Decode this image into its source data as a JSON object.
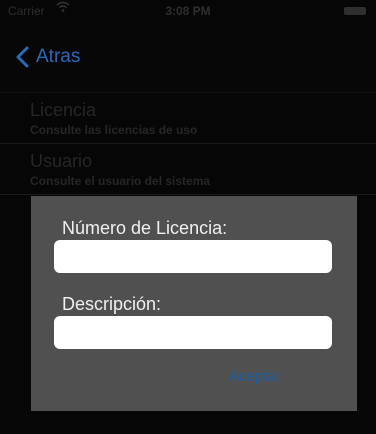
{
  "status_bar": {
    "carrier": "Carrier",
    "time": "3:08 PM",
    "wifi_icon": "wifi-icon",
    "battery_icon": "battery-icon"
  },
  "nav": {
    "back_label": "Atras",
    "back_icon": "chevron-left-icon"
  },
  "table": {
    "rows": [
      {
        "title": "Licencia",
        "subtitle": "Consulte las licencias de uso"
      },
      {
        "title": "Usuario",
        "subtitle": "Consulte el usuario del sistema"
      }
    ]
  },
  "dialog": {
    "license_label": "Número de Licencia:",
    "license_value": "",
    "description_label": "Descripción:",
    "description_value": "",
    "accept_label": "Aceptar"
  },
  "colors": {
    "accent": "#2a6ab8",
    "dialog_bg": "#505050",
    "screen_bg": "#060606"
  }
}
